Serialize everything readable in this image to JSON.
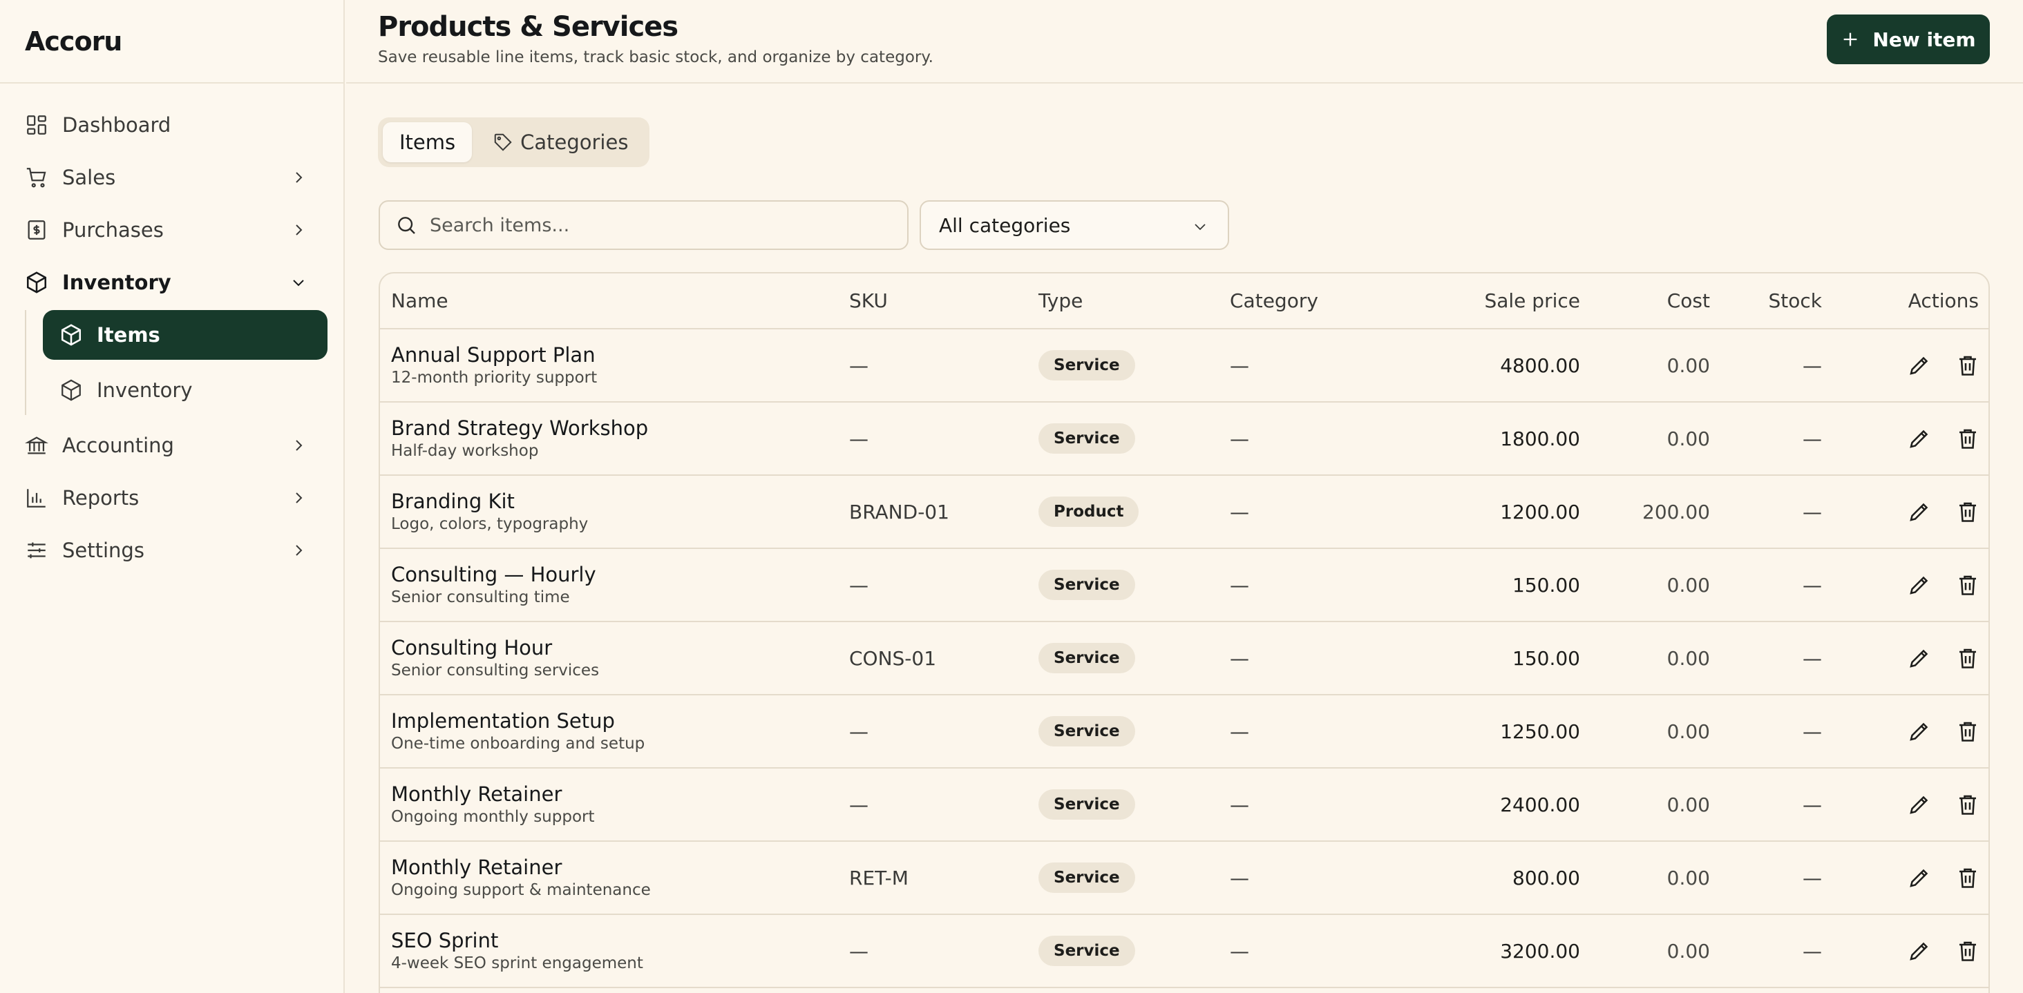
{
  "app": {
    "name": "Accoru"
  },
  "sidebar": {
    "items": [
      {
        "label": "Dashboard",
        "icon": "dashboard-icon"
      },
      {
        "label": "Sales",
        "icon": "cart-icon"
      },
      {
        "label": "Purchases",
        "icon": "receipt-icon"
      },
      {
        "label": "Inventory",
        "icon": "box-icon",
        "expanded": true
      },
      {
        "label": "Accounting",
        "icon": "bank-icon"
      },
      {
        "label": "Reports",
        "icon": "bar-chart-icon"
      },
      {
        "label": "Settings",
        "icon": "sliders-icon"
      }
    ],
    "inventory_children": [
      {
        "label": "Items",
        "icon": "box-icon",
        "active": true
      },
      {
        "label": "Inventory",
        "icon": "box-icon"
      }
    ]
  },
  "header": {
    "title": "Products & Services",
    "subtitle": "Save reusable line items, track basic stock, and organize by category.",
    "new_button": "New item"
  },
  "tabs": [
    {
      "label": "Items",
      "active": true
    },
    {
      "label": "Categories",
      "icon": "tag-icon"
    }
  ],
  "filters": {
    "search_placeholder": "Search items...",
    "category_select": "All categories"
  },
  "table": {
    "headers": [
      "Name",
      "SKU",
      "Type",
      "Category",
      "Sale price",
      "Cost",
      "Stock",
      "Actions"
    ],
    "rows": [
      {
        "name": "Annual Support Plan",
        "desc": "12-month priority support",
        "sku": "—",
        "type": "Service",
        "category": "—",
        "price": "4800.00",
        "cost": "0.00",
        "stock": "—"
      },
      {
        "name": "Brand Strategy Workshop",
        "desc": "Half-day workshop",
        "sku": "—",
        "type": "Service",
        "category": "—",
        "price": "1800.00",
        "cost": "0.00",
        "stock": "—"
      },
      {
        "name": "Branding Kit",
        "desc": "Logo, colors, typography",
        "sku": "BRAND-01",
        "type": "Product",
        "category": "—",
        "price": "1200.00",
        "cost": "200.00",
        "stock": "—"
      },
      {
        "name": "Consulting — Hourly",
        "desc": "Senior consulting time",
        "sku": "—",
        "type": "Service",
        "category": "—",
        "price": "150.00",
        "cost": "0.00",
        "stock": "—"
      },
      {
        "name": "Consulting Hour",
        "desc": "Senior consulting services",
        "sku": "CONS-01",
        "type": "Service",
        "category": "—",
        "price": "150.00",
        "cost": "0.00",
        "stock": "—"
      },
      {
        "name": "Implementation Setup",
        "desc": "One-time onboarding and setup",
        "sku": "—",
        "type": "Service",
        "category": "—",
        "price": "1250.00",
        "cost": "0.00",
        "stock": "—"
      },
      {
        "name": "Monthly Retainer",
        "desc": "Ongoing monthly support",
        "sku": "—",
        "type": "Service",
        "category": "—",
        "price": "2400.00",
        "cost": "0.00",
        "stock": "—"
      },
      {
        "name": "Monthly Retainer",
        "desc": "Ongoing support & maintenance",
        "sku": "RET-M",
        "type": "Service",
        "category": "—",
        "price": "800.00",
        "cost": "0.00",
        "stock": "—"
      },
      {
        "name": "SEO Sprint",
        "desc": "4-week SEO sprint engagement",
        "sku": "—",
        "type": "Service",
        "category": "—",
        "price": "3200.00",
        "cost": "0.00",
        "stock": "—"
      }
    ]
  },
  "colors": {
    "accent": "#173a2b",
    "background": "#fcf6ec",
    "badge": "#ede5d6"
  }
}
